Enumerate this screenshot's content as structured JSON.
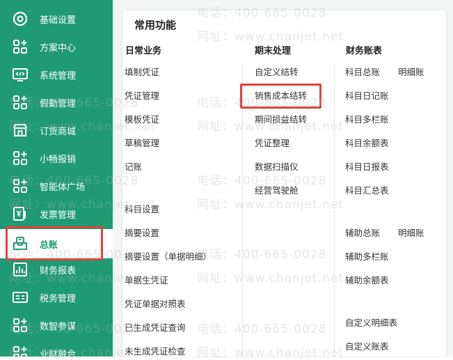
{
  "sidebar": {
    "items": [
      {
        "label": "基础设置",
        "icon": "gear-icon"
      },
      {
        "label": "方案中心",
        "icon": "apps-plus-icon"
      },
      {
        "label": "系统管理",
        "icon": "monitor-code-icon"
      },
      {
        "label": "假勤管理",
        "icon": "apps-plus-icon"
      },
      {
        "label": "订货商城",
        "icon": "shop-icon"
      },
      {
        "label": "小畅报销",
        "icon": "apps-plus-icon"
      },
      {
        "label": "智能体广场",
        "icon": "apps-plus-icon"
      },
      {
        "label": "发票管理",
        "icon": "invoice-icon"
      },
      {
        "label": "总账",
        "icon": "ledger-icon",
        "active": true
      },
      {
        "label": "财务报表",
        "icon": "report-icon"
      },
      {
        "label": "税务管理",
        "icon": "tax-icon"
      },
      {
        "label": "数智参谋",
        "icon": "apps-plus-icon"
      },
      {
        "label": "业财融合",
        "icon": "apps-plus-icon"
      }
    ],
    "accent": "#1f9a72"
  },
  "panel": {
    "title": "常用功能",
    "columns": [
      {
        "heading": "日常业务",
        "items": [
          "填制凭证",
          "凭证管理",
          "模板凭证",
          "草稿管理",
          "记账",
          "科目设置",
          "摘要设置",
          "摘要设置（单据明细）",
          "单据生凭证",
          "凭证单据对照表",
          "已生成凭证查询",
          "未生成凭证检查"
        ]
      },
      {
        "heading": "期末处理",
        "items": [
          "自定义结转",
          "销售成本结转",
          "期间损益结转",
          "凭证整理",
          "数据扫描仪",
          "经营驾驶舱"
        ]
      },
      {
        "heading": "财务账表",
        "items": [
          "科目总账",
          "明细账",
          "科目日记账",
          "科目多栏账",
          "科目余额表",
          "科目日报表",
          "科目汇总表",
          "辅助总账",
          "明细账",
          "辅助多栏账",
          "辅助余额表",
          "自定义明细表",
          "自定义账表"
        ]
      }
    ],
    "highlighted_item": "销售成本结转",
    "highlight_color": "#e0423b"
  },
  "watermark": {
    "phone": "电话：400-665-0028",
    "site": "网址：www.chanjet.net"
  }
}
